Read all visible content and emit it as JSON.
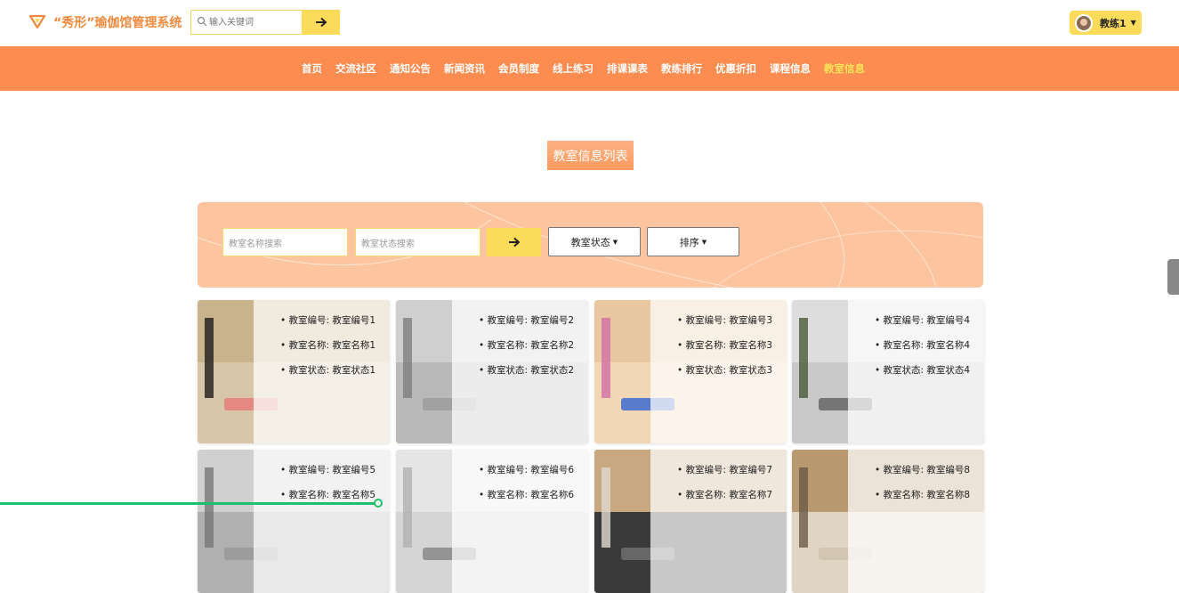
{
  "brand": {
    "title": "“秀形”瑜伽馆管理系统",
    "accent": "#f08a3e"
  },
  "search": {
    "placeholder": "输入关键词",
    "go_icon": "arrow-right-icon"
  },
  "user": {
    "name": "教练1",
    "caret": "▼"
  },
  "nav": {
    "items": [
      "首页",
      "交流社区",
      "通知公告",
      "新闻资讯",
      "会员制度",
      "线上练习",
      "排课课表",
      "教练排行",
      "优惠折扣",
      "课程信息",
      "教室信息"
    ],
    "active_index": 10,
    "background": "#fc8c4f"
  },
  "page_title": "教室信息列表",
  "filter": {
    "name_placeholder": "教室名称搜索",
    "status_placeholder": "教室状态搜索",
    "status_dropdown": "教室状态",
    "sort_dropdown": "排序",
    "caret": "▼"
  },
  "cards": [
    {
      "no": "• 教室编号: 教室编号1",
      "name": "• 教室名称: 教室名称1",
      "status": "• 教室状态: 教室状态1"
    },
    {
      "no": "• 教室编号: 教室编号2",
      "name": "• 教室名称: 教室名称2",
      "status": "• 教室状态: 教室状态2"
    },
    {
      "no": "• 教室编号: 教室编号3",
      "name": "• 教室名称: 教室名称3",
      "status": "• 教室状态: 教室状态3"
    },
    {
      "no": "• 教室编号: 教室编号4",
      "name": "• 教室名称: 教室名称4",
      "status": "• 教室状态: 教室状态4"
    },
    {
      "no": "• 教室编号: 教室编号5",
      "name": "• 教室名称: 教室名称5"
    },
    {
      "no": "• 教室编号: 教室编号6",
      "name": "• 教室名称: 教室名称6"
    },
    {
      "no": "• 教室编号: 教室编号7",
      "name": "• 教室名称: 教室名称7"
    },
    {
      "no": "• 教室编号: 教室编号8",
      "name": "• 教室名称: 教室名称8"
    }
  ]
}
